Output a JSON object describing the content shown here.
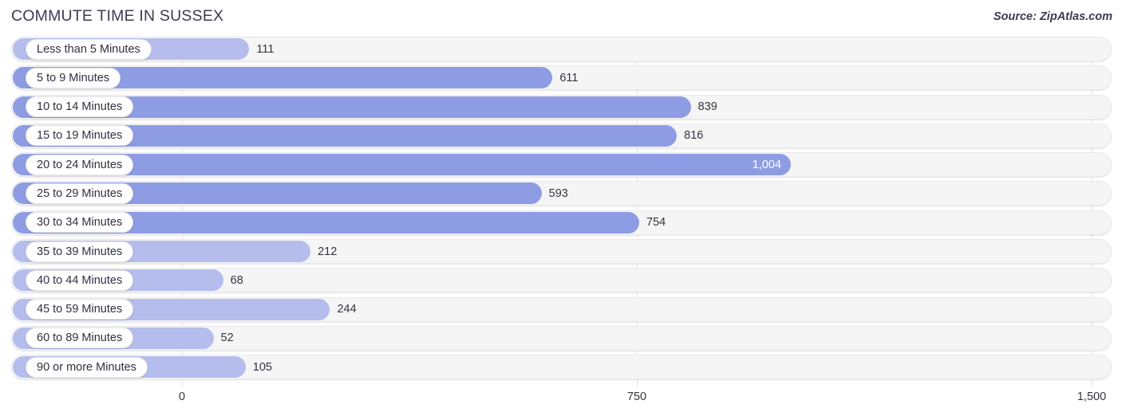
{
  "header": {
    "title": "COMMUTE TIME IN SUSSEX",
    "source": "Source: ZipAtlas.com"
  },
  "chart_data": {
    "type": "bar",
    "orientation": "horizontal",
    "title": "COMMUTE TIME IN SUSSEX",
    "xlabel": "",
    "ylabel": "",
    "xlim": [
      0,
      1500
    ],
    "grid": true,
    "legend": false,
    "xticks": [
      "0",
      "750",
      "1,500"
    ],
    "xtick_values": [
      0,
      750,
      1500
    ],
    "categories": [
      "Less than 5 Minutes",
      "5 to 9 Minutes",
      "10 to 14 Minutes",
      "15 to 19 Minutes",
      "20 to 24 Minutes",
      "25 to 29 Minutes",
      "30 to 34 Minutes",
      "35 to 39 Minutes",
      "40 to 44 Minutes",
      "45 to 59 Minutes",
      "60 to 89 Minutes",
      "90 or more Minutes"
    ],
    "values": [
      111,
      611,
      839,
      816,
      1004,
      593,
      754,
      212,
      68,
      244,
      52,
      105
    ],
    "value_labels": [
      "111",
      "611",
      "839",
      "816",
      "1,004",
      "593",
      "754",
      "212",
      "68",
      "244",
      "52",
      "105"
    ],
    "colors": {
      "bar": "#8e9ce4",
      "bar_light": "#b4bdec",
      "track": "#f5f5f6",
      "gridline": "#e3e3e6",
      "text": "#34343f"
    },
    "rows": [
      {
        "label": "Less than 5 Minutes",
        "value": 111,
        "value_label": "111",
        "shade": "light",
        "inside": false
      },
      {
        "label": "5 to 9 Minutes",
        "value": 611,
        "value_label": "611",
        "shade": "dark",
        "inside": false
      },
      {
        "label": "10 to 14 Minutes",
        "value": 839,
        "value_label": "839",
        "shade": "dark",
        "inside": false
      },
      {
        "label": "15 to 19 Minutes",
        "value": 816,
        "value_label": "816",
        "shade": "dark",
        "inside": false
      },
      {
        "label": "20 to 24 Minutes",
        "value": 1004,
        "value_label": "1,004",
        "shade": "dark",
        "inside": true
      },
      {
        "label": "25 to 29 Minutes",
        "value": 593,
        "value_label": "593",
        "shade": "dark",
        "inside": false
      },
      {
        "label": "30 to 34 Minutes",
        "value": 754,
        "value_label": "754",
        "shade": "dark",
        "inside": false
      },
      {
        "label": "35 to 39 Minutes",
        "value": 212,
        "value_label": "212",
        "shade": "light",
        "inside": false
      },
      {
        "label": "40 to 44 Minutes",
        "value": 68,
        "value_label": "68",
        "shade": "light",
        "inside": false
      },
      {
        "label": "45 to 59 Minutes",
        "value": 244,
        "value_label": "244",
        "shade": "light",
        "inside": false
      },
      {
        "label": "60 to 89 Minutes",
        "value": 52,
        "value_label": "52",
        "shade": "light",
        "inside": false
      },
      {
        "label": "90 or more Minutes",
        "value": 105,
        "value_label": "105",
        "shade": "light",
        "inside": false
      }
    ]
  }
}
